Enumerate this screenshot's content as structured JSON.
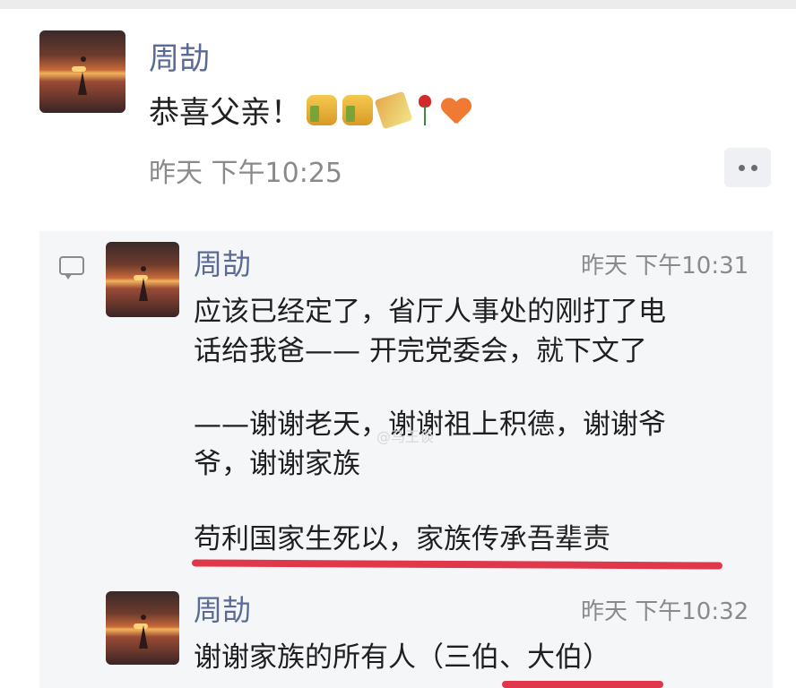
{
  "post": {
    "author": "周劼",
    "text": "恭喜父亲！",
    "timestamp": "昨天 下午10:25"
  },
  "comments": [
    {
      "author": "周劼",
      "time": "昨天 下午10:31",
      "lines": [
        "应该已经定了，省厅人事处的刚打了电",
        "话给我爸—— 开完党委会，就下文了",
        "——谢谢老天，谢谢祖上积德，谢谢爷",
        "爷，谢谢家族",
        "苟利国家生死以，家族传承吾辈责"
      ]
    },
    {
      "author": "周劼",
      "time": "昨天 下午10:32",
      "lines": [
        "谢谢家族的所有人（三伯、大伯）"
      ]
    }
  ],
  "watermark": "@马王谈",
  "icons": [
    "thumbs-up",
    "thumbs-up",
    "party-popper",
    "rose",
    "orange-heart",
    "more-dots",
    "comment-bubble"
  ],
  "colors": {
    "name": "#5a6a94",
    "comment_bg": "#f5f6f8",
    "underline": "#e0384a"
  }
}
